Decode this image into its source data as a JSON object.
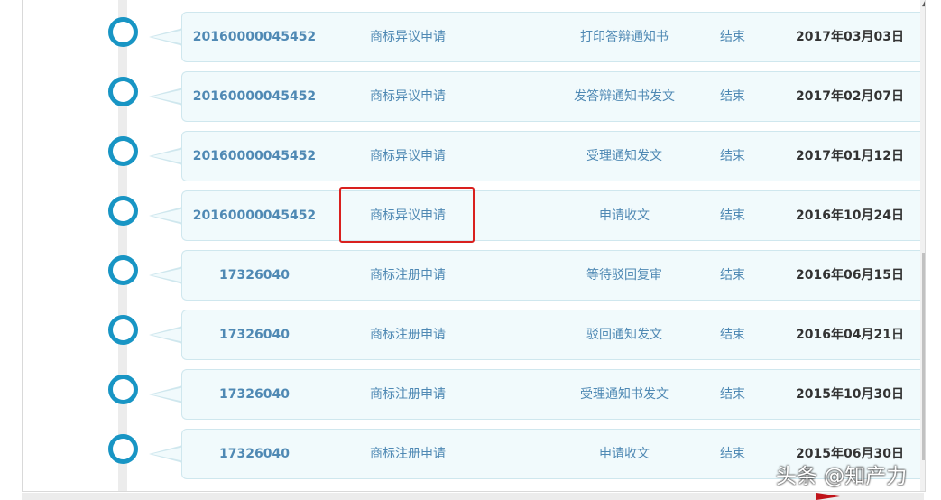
{
  "rows": [
    {
      "number": "20160000045452",
      "type": "商标异议申请",
      "step": "打印答辩通知书",
      "status": "结束",
      "date": "2017年03月03日"
    },
    {
      "number": "20160000045452",
      "type": "商标异议申请",
      "step": "发答辩通知书发文",
      "status": "结束",
      "date": "2017年02月07日"
    },
    {
      "number": "20160000045452",
      "type": "商标异议申请",
      "step": "受理通知发文",
      "status": "结束",
      "date": "2017年01月12日"
    },
    {
      "number": "20160000045452",
      "type": "商标异议申请",
      "step": "申请收文",
      "status": "结束",
      "date": "2016年10月24日"
    },
    {
      "number": "17326040",
      "type": "商标注册申请",
      "step": "等待驳回复审",
      "status": "结束",
      "date": "2016年06月15日"
    },
    {
      "number": "17326040",
      "type": "商标注册申请",
      "step": "驳回通知发文",
      "status": "结束",
      "date": "2016年04月21日"
    },
    {
      "number": "17326040",
      "type": "商标注册申请",
      "step": "受理通知书发文",
      "status": "结束",
      "date": "2015年10月30日"
    },
    {
      "number": "17326040",
      "type": "商标注册申请",
      "step": "申请收文",
      "status": "结束",
      "date": "2015年06月30日"
    }
  ],
  "watermark": "头条 @知产力",
  "colors": {
    "accent": "#1895c4",
    "link_text": "#4f89b4",
    "highlight": "#d9201e"
  }
}
